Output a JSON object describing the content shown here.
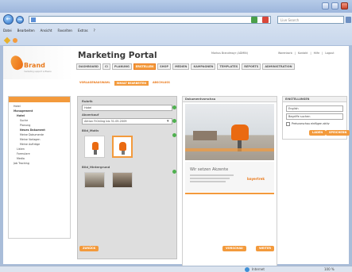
{
  "browser": {
    "search_placeholder": "Live Search",
    "menu": [
      "Datei",
      "Bearbeiten",
      "Ansicht",
      "Favoriten",
      "Extras",
      "?"
    ]
  },
  "header": {
    "brand_name": "Brand",
    "brand_tagline": "marketing support software",
    "portal_title": "Marketing Portal",
    "user_name": "Markus Brandmayr (ADMIN)",
    "utility_links": [
      "Warenkorb",
      "Kontakt",
      "Hilfe",
      "Logout"
    ]
  },
  "tabs": [
    {
      "label": "DASHBOARD",
      "active": false
    },
    {
      "label": "CI",
      "active": false
    },
    {
      "label": "PLANUNG",
      "active": false
    },
    {
      "label": "ERSTELLEN",
      "active": true
    },
    {
      "label": "SHOP",
      "active": false
    },
    {
      "label": "MEDIEN",
      "active": false
    },
    {
      "label": "KAMPAGNEN",
      "active": false
    },
    {
      "label": "TEMPLATES",
      "active": false
    },
    {
      "label": "REPORTS",
      "active": false
    },
    {
      "label": "ADMINISTRATION",
      "active": false
    }
  ],
  "subtabs": [
    {
      "label": "VORLAGENAUSWAHL",
      "active": false
    },
    {
      "label": "INHALT BEARBEITEN",
      "active": true
    },
    {
      "label": "ABSCHLUSS",
      "active": false
    }
  ],
  "sidebar": {
    "items": [
      {
        "label": "Hotel",
        "level": 1,
        "bold": false
      },
      {
        "label": "Management",
        "level": 1,
        "bold": true
      },
      {
        "label": "Hotel",
        "level": 2,
        "bold": true
      },
      {
        "label": "Suche",
        "level": 3,
        "bold": false
      },
      {
        "label": "Planung",
        "level": 3,
        "bold": false
      },
      {
        "label": "Neues Dokument",
        "level": 3,
        "bold": true
      },
      {
        "label": "Meine Dokumente",
        "level": 3,
        "bold": false
      },
      {
        "label": "Meine Vorlagen",
        "level": 3,
        "bold": false
      },
      {
        "label": "Meine Aufträge",
        "level": 3,
        "bold": false
      },
      {
        "label": "Listen",
        "level": 2,
        "bold": false
      },
      {
        "label": "Formulare",
        "level": 2,
        "bold": false
      },
      {
        "label": "Media",
        "level": 2,
        "bold": false
      },
      {
        "label": "Job Tracking",
        "level": 1,
        "bold": false
      }
    ]
  },
  "form": {
    "section_label": "Rubrik",
    "section_value": "Hotel",
    "offer_label": "Abverkauf",
    "offer_value": "Aktion Frühling bis 31.05.2009",
    "image_group_1": "Bild_Motiv",
    "image_group_2": "Bild_Hintergrund"
  },
  "preview": {
    "heading": "Dokumentvorschau",
    "headline": "Wir setzen Akzente",
    "footer_brand": "bayertrek"
  },
  "right_panel": {
    "heading": "EINSTELLUNGEN",
    "language": "English",
    "field2": "Begriffe suchen",
    "checkbox_label": "Preisvorschau einfügen aktiv",
    "btn_load": "LADEN",
    "btn_save": "SPEICHERN"
  },
  "footer_buttons": {
    "back": "ZURÜCK",
    "preview": "VORSCHAU",
    "next": "WEITER"
  },
  "statusbar": {
    "zone": "Internet",
    "zoom": "100 %"
  },
  "colors": {
    "accent": "#f39a3c",
    "accent_dark": "#ea7a1c"
  }
}
